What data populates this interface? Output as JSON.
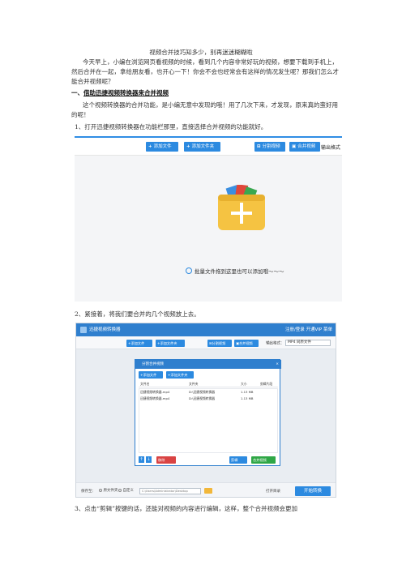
{
  "doc": {
    "title": "视频合并技巧知多少，别再迷迷糊糊啦",
    "intro": "今天早上，小编在浏览网页看视频的时候，看到几个内容非常好玩的视频，想要下载到手机上，然后合并在一起，拿给朋友看，也开心一下！你会不会也经常会有这样的情况发生呢？那我们怎么才能合并视频呢？",
    "heading_prefix": "一、",
    "heading_text": "借助迅捷视频转换器来合并视频",
    "para2": "这个视频转换器的合并功能，是小编无意中发现的哦！用了几次下来，才发现，原来真的蛮好用的呢！",
    "step1": "1、打开迅捷视频转换器在功能栏那里，直接选择合并视频的功能就好。",
    "step2": "2、紧接着，将我们要合并的几个视频放上去。",
    "step3": "3、点击“剪辑”按键的话，还能对视频的内容进行编辑，这样，整个合并视频会更加"
  },
  "shot1": {
    "add_file": "添加文件",
    "add_folder": "添加文件夹",
    "split_video": "分割视频",
    "merge_video": "合并视频",
    "output_format": "输出格式",
    "hint": "批量文件拖到这里也可以添加哦～～～",
    "folder_color": "#f5c342",
    "accent": "#2c8ae0"
  },
  "shot2": {
    "app_title": "迅捷视频转换器",
    "title_right": "注册/登录   开通VIP   菜单",
    "add_file": "添加文件",
    "add_folder": "添加文件夹",
    "split_video": "分割视频",
    "merge_video": "合并视频",
    "output_format_label": "输出格式：",
    "output_format_value": "MP4  同原文件",
    "dialog_title": "分割合并视频",
    "dialog_close": "×",
    "dlg_add_file": "添加文件",
    "dlg_add_folder": "添加文件夹",
    "col_name": "文件名",
    "col_path": "文件夹",
    "col_size": "大小",
    "col_action": "剪辑片段",
    "rows": [
      {
        "name": "迅捷视频转换器.mp4",
        "path": "D:\\迅捷视频转换器",
        "size": "1.13 MB"
      },
      {
        "name": "迅捷视频转换器.mp4",
        "path": "D:\\迅捷视频转换器",
        "size": "1.13 MB"
      }
    ],
    "remove": "移除",
    "clip": "剪辑",
    "merge": "合并视频",
    "save_to": "保存至：",
    "opt_source": "原文件夹",
    "opt_custom": "自定义",
    "save_path": "C:\\Users\\Administrator\\Desktop",
    "open_output": "打开目录",
    "start": "开始转换"
  }
}
